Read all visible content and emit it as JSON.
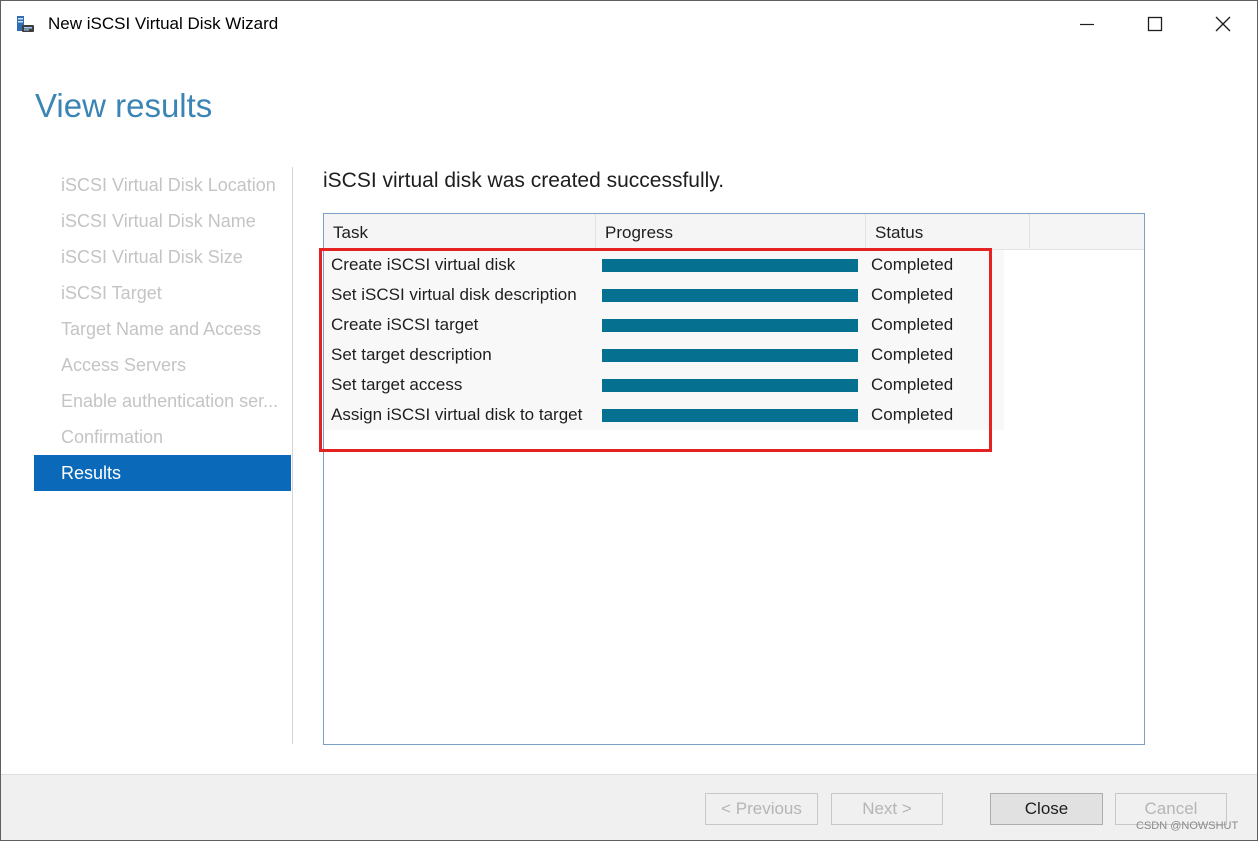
{
  "window": {
    "title": "New iSCSI Virtual Disk Wizard",
    "icons": {
      "app": "iscsi-disk-wizard-icon",
      "minimize": "minimize-icon",
      "maximize": "maximize-icon",
      "close": "close-icon"
    }
  },
  "page": {
    "title": "View results"
  },
  "nav": {
    "items": [
      {
        "label": "iSCSI Virtual Disk Location",
        "state": "disabled"
      },
      {
        "label": "iSCSI Virtual Disk Name",
        "state": "disabled"
      },
      {
        "label": "iSCSI Virtual Disk Size",
        "state": "disabled"
      },
      {
        "label": "iSCSI Target",
        "state": "disabled"
      },
      {
        "label": "Target Name and Access",
        "state": "disabled"
      },
      {
        "label": "Access Servers",
        "state": "disabled"
      },
      {
        "label": "Enable authentication ser...",
        "state": "disabled"
      },
      {
        "label": "Confirmation",
        "state": "disabled"
      },
      {
        "label": "Results",
        "state": "active"
      }
    ]
  },
  "main": {
    "message": "iSCSI virtual disk was created successfully.",
    "table": {
      "columns": [
        "Task",
        "Progress",
        "Status"
      ],
      "rows": [
        {
          "task": "Create iSCSI virtual disk",
          "progress": 100,
          "status": "Completed"
        },
        {
          "task": "Set iSCSI virtual disk description",
          "progress": 100,
          "status": "Completed"
        },
        {
          "task": "Create iSCSI target",
          "progress": 100,
          "status": "Completed"
        },
        {
          "task": "Set target description",
          "progress": 100,
          "status": "Completed"
        },
        {
          "task": "Set target access",
          "progress": 100,
          "status": "Completed"
        },
        {
          "task": "Assign iSCSI virtual disk to target",
          "progress": 100,
          "status": "Completed"
        }
      ]
    }
  },
  "footer": {
    "previous_label": "< Previous",
    "next_label": "Next >",
    "close_label": "Close",
    "cancel_label": "Cancel",
    "watermark": "CSDN @NOWSHUT"
  },
  "colors": {
    "accent": "#0a69b8",
    "title": "#3b85b6",
    "progress": "#05708f",
    "highlight": "#e52222"
  }
}
